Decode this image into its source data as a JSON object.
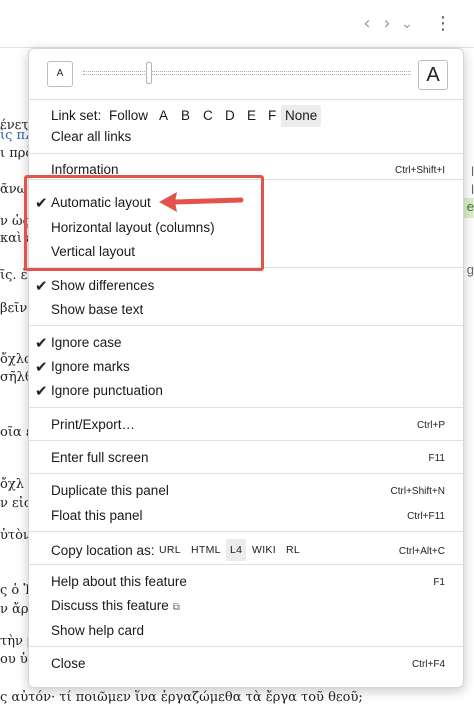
{
  "toolbar": {
    "prev_icon": "chevron-left-icon",
    "next_icon": "chevron-right-icon",
    "dropdown_icon": "chevron-down-icon",
    "more_icon": "kebab-menu-icon",
    "prev_glyph": "‹",
    "next_glyph": "›",
    "dropdown_glyph": "⌄",
    "more_glyph": "⋮"
  },
  "background": {
    "lines": [
      "ένετο.",
      "ὶς πλο",
      "ι πρὸ",
      "ᾶνω",
      "ν ὡς",
      "καὶ ε",
      "ῖς. ἐγ",
      "βεῖν ο",
      "ὄχλο",
      "σῆλθ",
      "οῖα ἐ",
      "ὄχλ",
      "ν εἰς",
      "ὐτὸν",
      "ς ὁ Ἰ",
      "ν ἄρτ",
      "τὴν β",
      "ου ὑ"
    ],
    "bottom_line": "ς αὐτόν· τί ποιῶμεν ἵνα ἐργαζώμεθα τὰ ἔργα τοῦ θεοῦ;",
    "right_letters": [
      "l",
      "l",
      "e",
      "g"
    ]
  },
  "font_size": {
    "small_label": "A",
    "large_label": "A",
    "level": 0.2
  },
  "link_set": {
    "title": "Link set:",
    "options": [
      "Follow",
      "A",
      "B",
      "C",
      "D",
      "E",
      "F",
      "None"
    ],
    "selected": "None"
  },
  "menu": {
    "clear_links": "Clear all links",
    "information": {
      "label": "Information",
      "shortcut": "Ctrl+Shift+I"
    },
    "layout": {
      "automatic": "Automatic layout",
      "horizontal": "Horizontal layout (columns)",
      "vertical": "Vertical layout",
      "check": "✔"
    },
    "show_differences": "Show differences",
    "show_base_text": "Show base text",
    "ignore_case": "Ignore case",
    "ignore_marks": "Ignore marks",
    "ignore_punctuation": "Ignore punctuation",
    "print_export": {
      "label": "Print/Export…",
      "shortcut": "Ctrl+P"
    },
    "full_screen": {
      "label": "Enter full screen",
      "shortcut": "F11"
    },
    "duplicate": {
      "label": "Duplicate this panel",
      "shortcut": "Ctrl+Shift+N"
    },
    "float": {
      "label": "Float this panel",
      "shortcut": "Ctrl+F11"
    },
    "copy_location": {
      "label": "Copy location as:",
      "options": [
        "URL",
        "HTML",
        "L4",
        "WIKI",
        "RL"
      ],
      "selected": "L4",
      "shortcut": "Ctrl+Alt+C"
    },
    "help_feature": {
      "label": "Help about this feature",
      "shortcut": "F1"
    },
    "discuss_feature": {
      "label": "Discuss this feature",
      "icon": "external-link-icon",
      "glyph": "⧉"
    },
    "help_card": "Show help card",
    "close": {
      "label": "Close",
      "shortcut": "Ctrl+F4"
    }
  },
  "annotation": {
    "color": "#e4534b"
  }
}
